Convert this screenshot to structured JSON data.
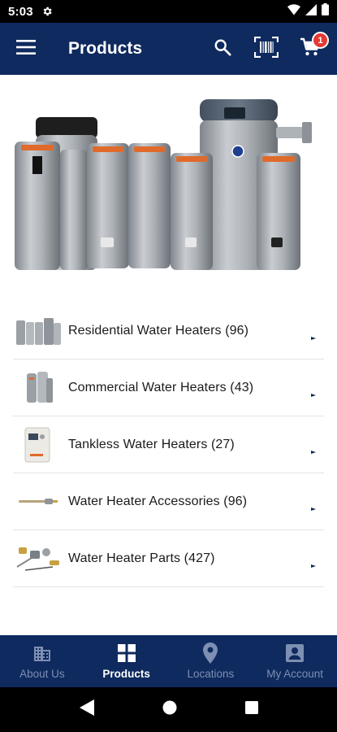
{
  "status_bar": {
    "time": "5:03"
  },
  "app_bar": {
    "title": "Products",
    "cart_count": "1"
  },
  "hero": {
    "image": "water-heater-lineup"
  },
  "categories": [
    {
      "label": "Residential Water Heaters (96)",
      "icon": "residential-thumb"
    },
    {
      "label": "Commercial Water Heaters (43)",
      "icon": "commercial-thumb"
    },
    {
      "label": "Tankless Water Heaters (27)",
      "icon": "tankless-thumb"
    },
    {
      "label": "Water Heater Accessories (96)",
      "icon": "accessories-thumb"
    },
    {
      "label": "Water Heater Parts (427)",
      "icon": "parts-thumb"
    }
  ],
  "bottom_nav": [
    {
      "label": "About Us",
      "icon": "building-icon",
      "active": false
    },
    {
      "label": "Products",
      "icon": "grid-icon",
      "active": true
    },
    {
      "label": "Locations",
      "icon": "map-pin-icon",
      "active": false
    },
    {
      "label": "My Account",
      "icon": "account-icon",
      "active": false
    }
  ],
  "colors": {
    "brand_navy": "#0f2a5e",
    "badge_red": "#e53935",
    "nav_inactive": "#7d8fb3"
  }
}
